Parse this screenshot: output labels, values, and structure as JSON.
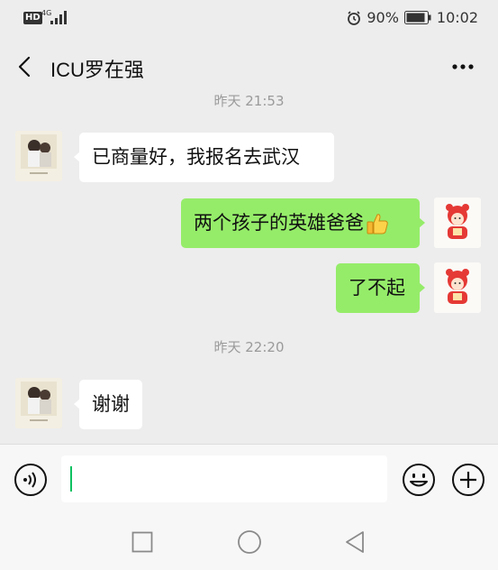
{
  "status_bar": {
    "hd_label": "HD",
    "network_label": "4G",
    "battery_percent": "90%",
    "time": "10:02"
  },
  "header": {
    "back_icon": "chevron-left-icon",
    "title": "ICU罗在强",
    "more_icon": "more-dots-icon"
  },
  "messages": [
    {
      "type": "timestamp",
      "text": "昨天 21:53"
    },
    {
      "type": "text",
      "sender": "contact",
      "text": "已商量好，我报名去武汉"
    },
    {
      "type": "text",
      "sender": "me",
      "text": "两个孩子的英雄爸爸",
      "emoji": "thumbs-up-icon"
    },
    {
      "type": "text",
      "sender": "me",
      "text": "了不起"
    },
    {
      "type": "timestamp",
      "text": "昨天 22:20"
    },
    {
      "type": "text",
      "sender": "contact",
      "text": "谢谢"
    }
  ],
  "input_bar": {
    "voice_icon": "voice-icon",
    "input_value": "",
    "emoji_icon": "emoji-smile-icon",
    "plus_icon": "plus-icon"
  },
  "system_nav": {
    "recents_icon": "square-recents-icon",
    "home_icon": "circle-home-icon",
    "back_icon": "triangle-back-icon"
  },
  "colors": {
    "chat_background": "#ededed",
    "outgoing_bubble": "#95ec69",
    "incoming_bubble": "#ffffff",
    "timestamp_text": "#9a9a9a",
    "cursor": "#07c160"
  }
}
